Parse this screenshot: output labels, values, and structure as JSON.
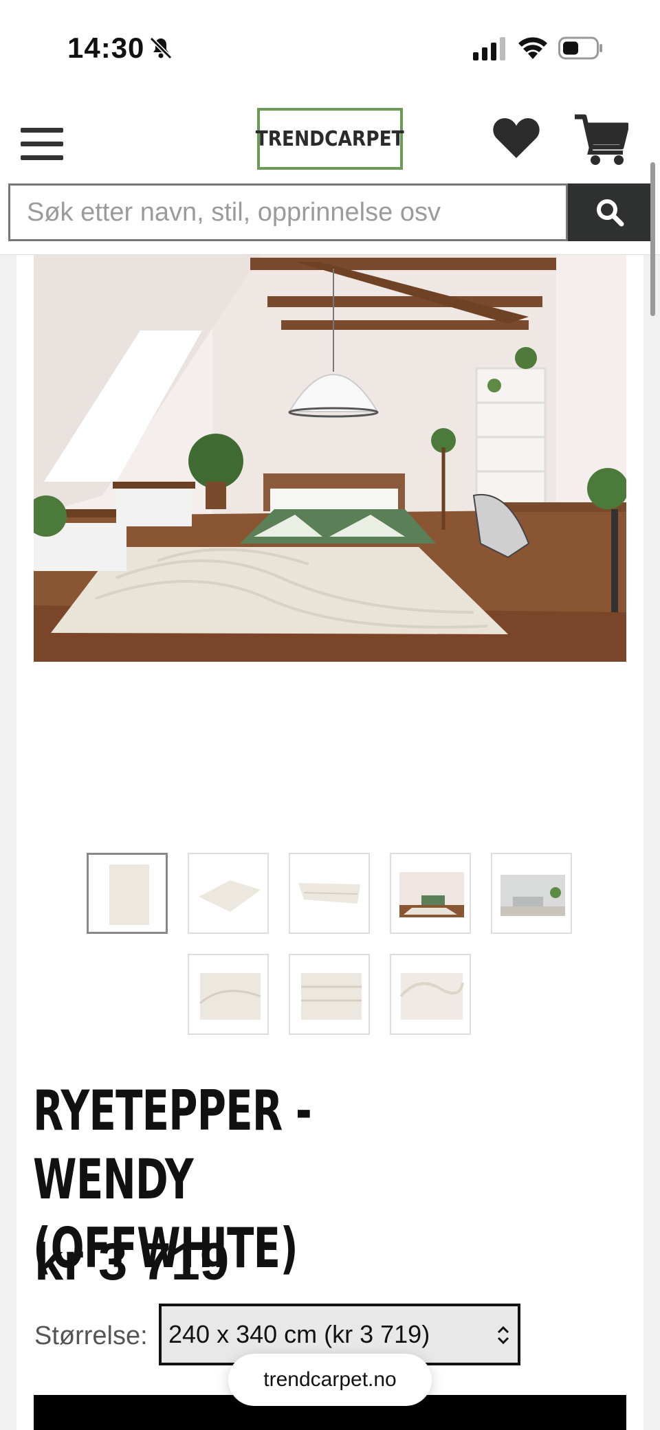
{
  "status_bar": {
    "time": "14:30"
  },
  "header": {
    "logo_text": "TRENDCARPET",
    "search_placeholder": "Søk etter navn, stil, opprinnelse osv"
  },
  "product": {
    "title_line1": "RYETEPPER - WENDY",
    "title_line2": "(OFFWHITE)",
    "price": "kr 3 719",
    "size_label": "Størrelse:",
    "size_selected": "240 x 340 cm (kr 3 719)"
  },
  "thumbnails": [
    {
      "name": "rug-top-view"
    },
    {
      "name": "rug-angle-view"
    },
    {
      "name": "rug-edge-view"
    },
    {
      "name": "bedroom-scene"
    },
    {
      "name": "living-room-scene"
    },
    {
      "name": "rug-pattern-closeup-1"
    },
    {
      "name": "rug-pattern-closeup-2"
    },
    {
      "name": "rug-texture-closeup"
    }
  ],
  "browser": {
    "url": "trendcarpet.no"
  },
  "colors": {
    "logo_border": "#6b9a58",
    "search_button": "#2f3030",
    "buy_button": "#000000"
  }
}
